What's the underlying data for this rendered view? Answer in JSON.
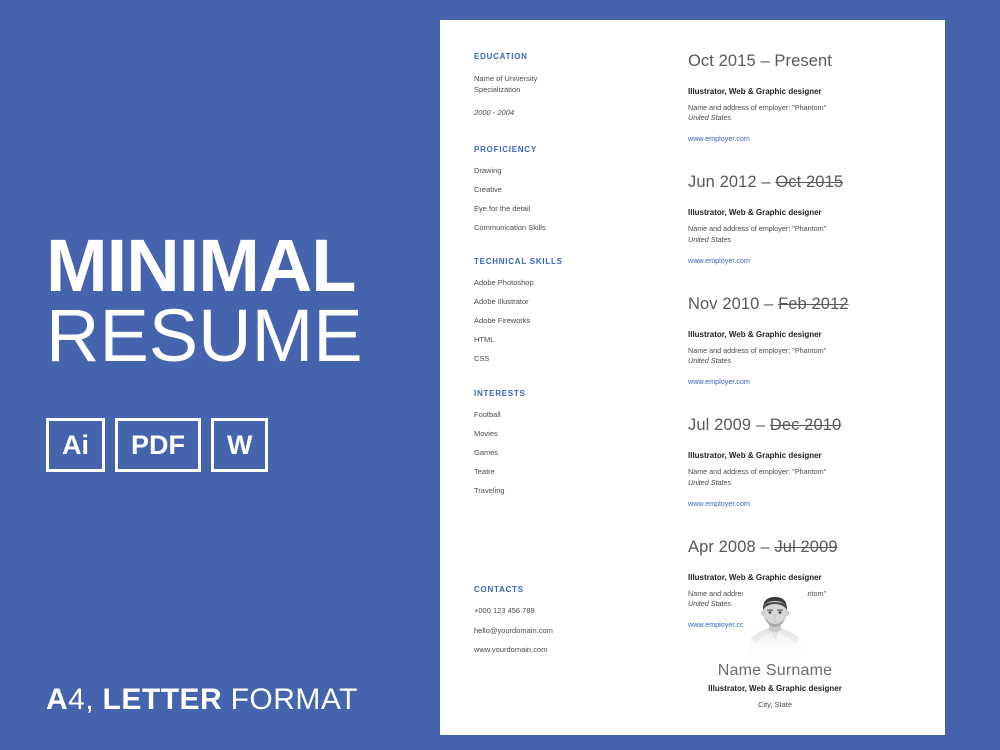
{
  "promo": {
    "title_line1": "MINIMAL",
    "title_line2": "RESUME",
    "badges": [
      {
        "label": "Ai",
        "name": "badge-ai"
      },
      {
        "label": "PDF",
        "name": "badge-pdf"
      },
      {
        "label": "W",
        "name": "badge-word"
      }
    ],
    "footer": {
      "part1": "A",
      "part2": "4,",
      "part3": "LETTER",
      "part4": "FORMAT"
    },
    "background_color": "#4663ae",
    "text_color": "#ffffff"
  },
  "resume": {
    "accent_color": "#3b63c4",
    "sections": {
      "education": {
        "heading": "EDUCATION",
        "university": "Name of University",
        "specialization": "Specialization",
        "years": "2000 - 2004"
      },
      "proficiency": {
        "heading": "PROFICIENCY",
        "items": [
          "Drawing",
          "Creative",
          "Eye for the detail",
          "Communication Skills"
        ]
      },
      "technical_skills": {
        "heading": "TECHNICAL SKILLS",
        "items": [
          "Adobe Photoshop",
          "Adobe Illustrator",
          "Adobe Fireworks",
          "HTML",
          "CSS"
        ]
      },
      "interests": {
        "heading": "INTERESTS",
        "items": [
          "Football",
          "Movies",
          "Games",
          "Teatre",
          "Traveling"
        ]
      },
      "contacts": {
        "heading": "CONTACTS",
        "items": [
          "+000 123 456 789",
          "hello@yourdomain.com",
          "www.yourdomain.com"
        ]
      }
    },
    "experience": [
      {
        "date_start": "Oct 2015",
        "date_sep": " – ",
        "date_end": "Present",
        "date_end_struck": false,
        "role": "Illustrator, Web & Graphic designer",
        "employer": "Name and address of employer: \"Phantom\"",
        "country": "United States",
        "url": "www.employer.com"
      },
      {
        "date_start": "Jun 2012",
        "date_sep": " – ",
        "date_end": "Oct 2015",
        "date_end_struck": true,
        "role": "Illustrator, Web & Graphic designer",
        "employer": "Name and address of employer: \"Phantom\"",
        "country": "United States",
        "url": "www.employer.com"
      },
      {
        "date_start": "Nov 2010",
        "date_sep": " – ",
        "date_end": "Feb 2012",
        "date_end_struck": true,
        "role": "Illustrator, Web & Graphic designer",
        "employer": "Name and address of employer: \"Phantom\"",
        "country": "United States",
        "url": "www.employer.com"
      },
      {
        "date_start": "Jul 2009",
        "date_sep": " – ",
        "date_end": "Dec 2010",
        "date_end_struck": true,
        "role": "Illustrator, Web & Graphic designer",
        "employer": "Name and address of employer: \"Phantom\"",
        "country": "United States",
        "url": "www.employer.com"
      },
      {
        "date_start": "Apr 2008",
        "date_sep": " – ",
        "date_end": "Jul 2009",
        "date_end_struck": true,
        "role": "Illustrator, Web & Graphic designer",
        "employer": "Name and address of employer: \"Phantom\"",
        "country": "United States",
        "url": "www.employer.com"
      }
    ],
    "identity": {
      "photo": "portrait-photo",
      "name": "Name Surname",
      "role": "Illustrator, Web & Graphic designer",
      "location": "City, State"
    }
  }
}
